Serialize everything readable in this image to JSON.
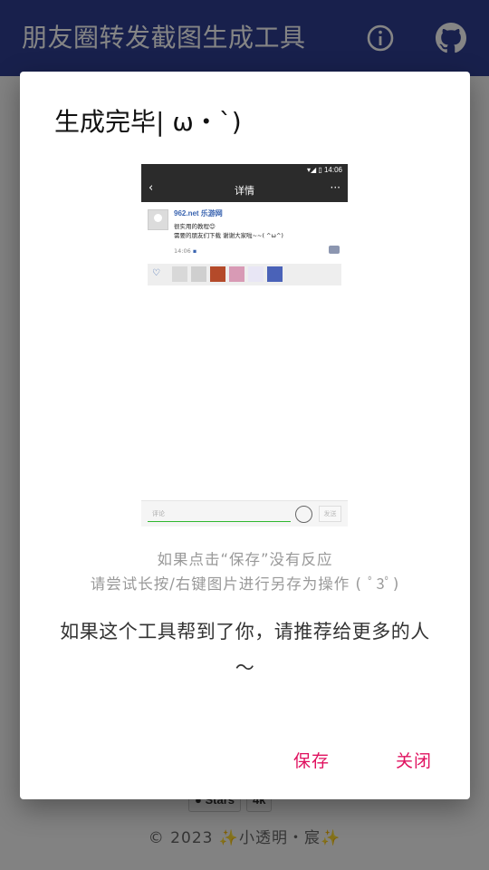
{
  "appbar": {
    "title": "朋友圈转发截图生成工具",
    "info_icon": "info-icon",
    "github_icon": "github-icon"
  },
  "footer": {
    "badge_stars": "Stars",
    "badge_count": "4k",
    "copyright_prefix": "© 2023",
    "author": "小透明・宸",
    "sparkle_icon": "sparkle-icon"
  },
  "dialog": {
    "title": "生成完毕| ω・`)",
    "hint_line1": "如果点击“保存”没有反应",
    "hint_line2": "请尝试长按/右键图片进行另存为操作 ( ﾟ3ﾟ)",
    "share_text": "如果这个工具帮到了你，请推荐给更多的人～",
    "save_label": "保存",
    "close_label": "关闭"
  },
  "preview": {
    "status_time": "14:06",
    "header_title": "详情",
    "back_icon": "back-arrow-icon",
    "more_icon": "more-icon",
    "author_name": "962.net 乐游网",
    "content_line1": "很实用的教程😊",
    "content_line2": "需要的朋友们下载 谢谢大家啦~~( ^ω^)",
    "post_time": "14:06",
    "heart_icon": "heart-icon",
    "comment_placeholder": "评论",
    "send_label": "发送"
  },
  "colors": {
    "appbar": "#2f3f93",
    "accent": "#e0115f",
    "scrim": "rgba(0,0,0,0.48)"
  }
}
